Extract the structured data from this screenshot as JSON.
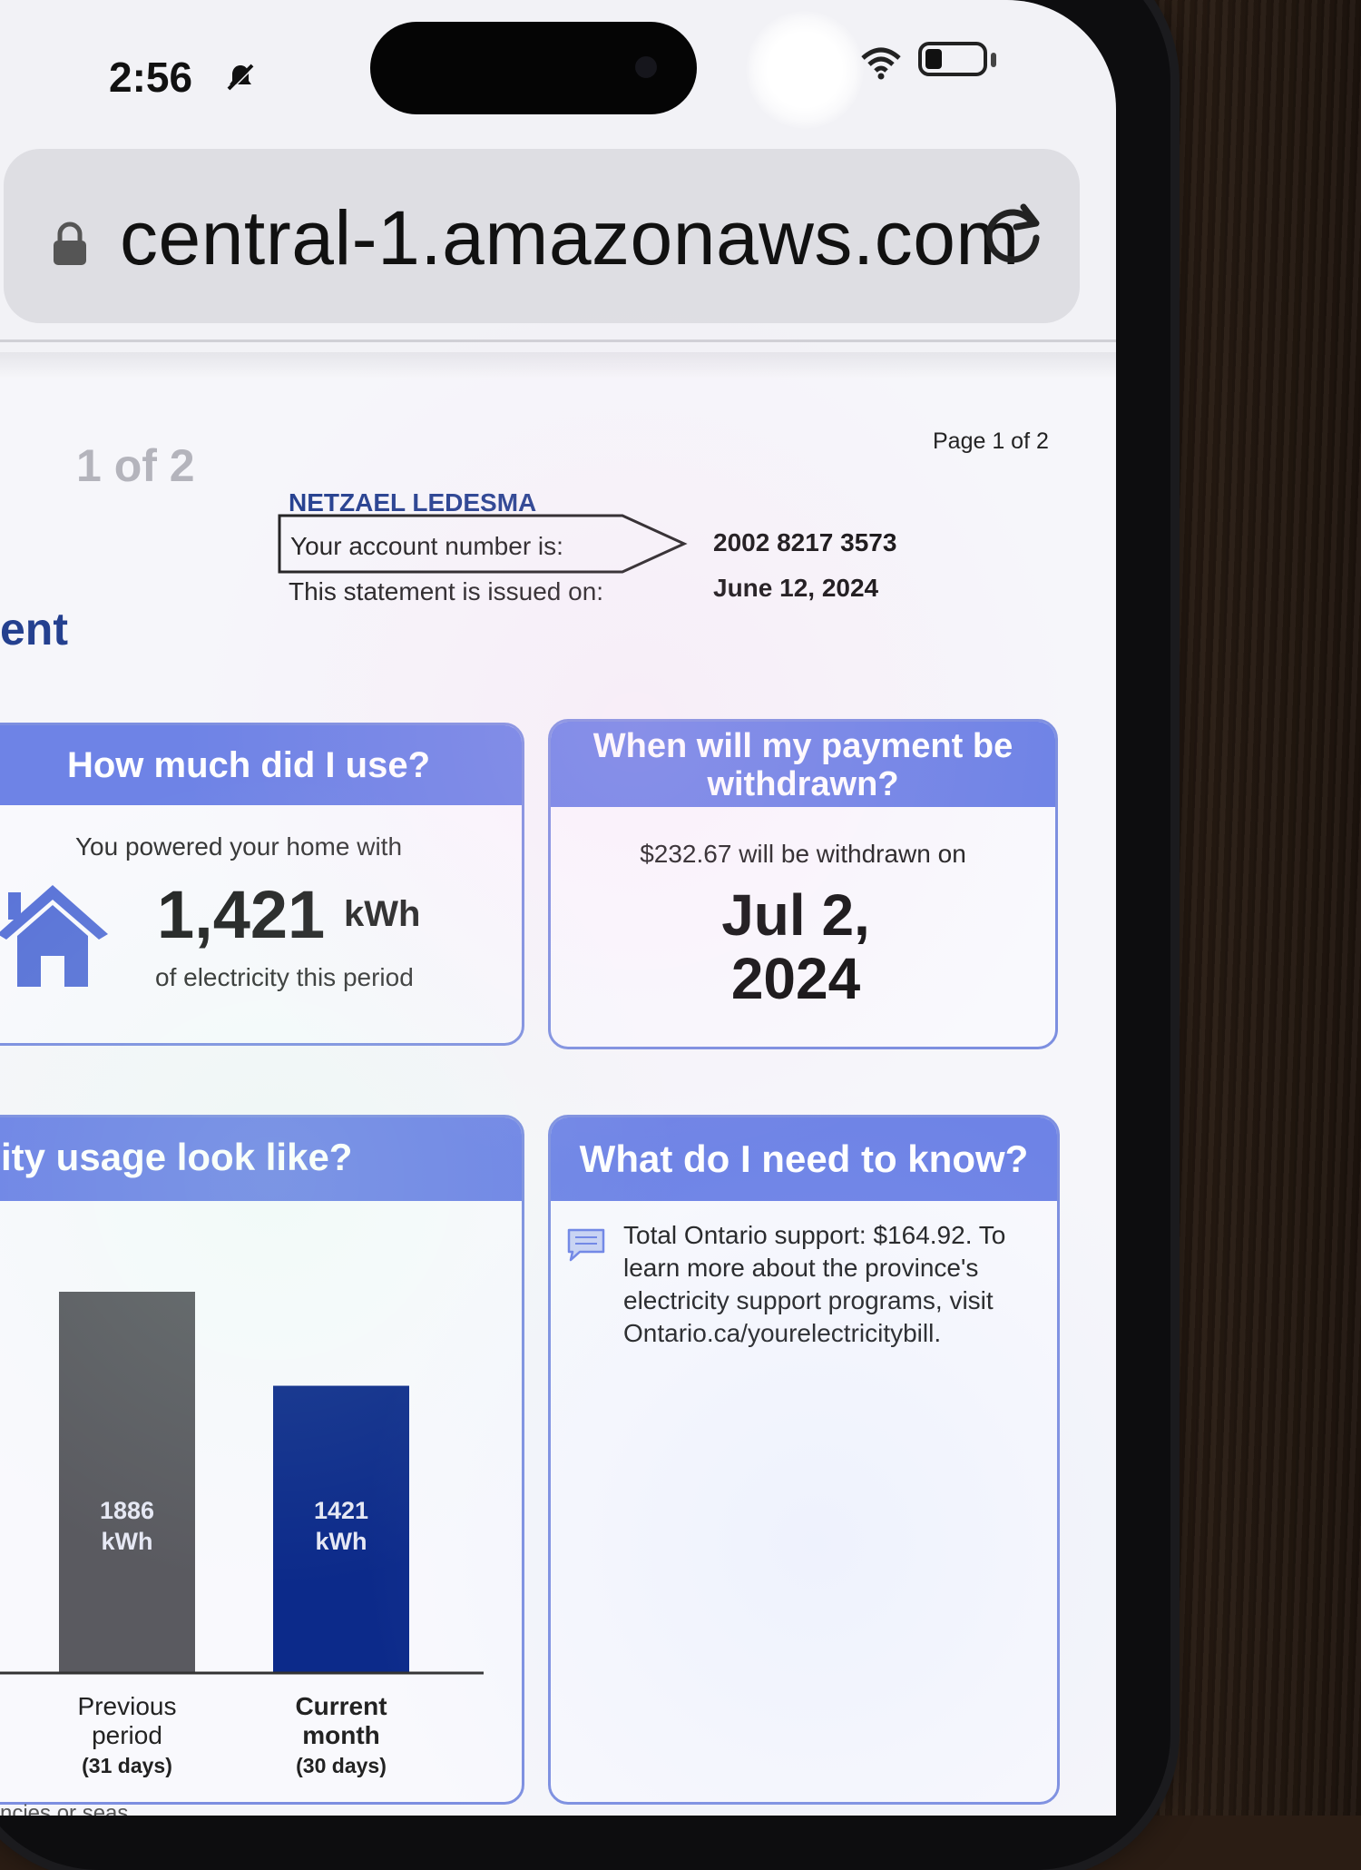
{
  "status_bar": {
    "time": "2:56"
  },
  "browser": {
    "url": "central-1.amazonaws.com"
  },
  "statement": {
    "page_counter": "1 of 2",
    "page_label": "Page 1 of 2",
    "customer_name": "NETZAEL LEDESMA",
    "account_label": "Your account number is:",
    "account_number": "2002 8217 3573",
    "issued_label": "This statement is issued on:",
    "issued_date": "June 12, 2024",
    "section_title_fragment": "ent"
  },
  "usage_card": {
    "title": "How much did I use?",
    "intro": "You powered your home with",
    "amount": "1,421",
    "unit": "kWh",
    "subtitle": "of electricity this period"
  },
  "payment_card": {
    "title": "When will my payment be withdrawn?",
    "text": "$232.67 will be withdrawn on",
    "date": "Jul 2, 2024"
  },
  "chart_card": {
    "title": "ity usage look like?"
  },
  "info_card": {
    "title": "What do I need to know?",
    "message": "Total Ontario support: $164.92. To learn more about the province's electricity support programs, visit Ontario.ca/yourelectricitybill."
  },
  "footer_fragment": "ncies or seas",
  "colors": {
    "accent": "#6e83e6",
    "current_bar": "#0c2a8a",
    "previous_bar": "#5a5a60",
    "text_blue": "#24408f"
  },
  "chart_data": {
    "type": "bar",
    "categories": [
      "Previous period (31 days)",
      "Current month (30 days)"
    ],
    "category_lines": [
      [
        "Previous",
        "period",
        "(31 days)"
      ],
      [
        "Current",
        "month",
        "(30 days)"
      ]
    ],
    "values": [
      1886,
      1421
    ],
    "value_labels": [
      [
        "1886",
        "kWh"
      ],
      [
        "1421",
        "kWh"
      ]
    ],
    "unit": "kWh",
    "ylim": [
      0,
      1886
    ],
    "grid": false,
    "legend": "none"
  }
}
